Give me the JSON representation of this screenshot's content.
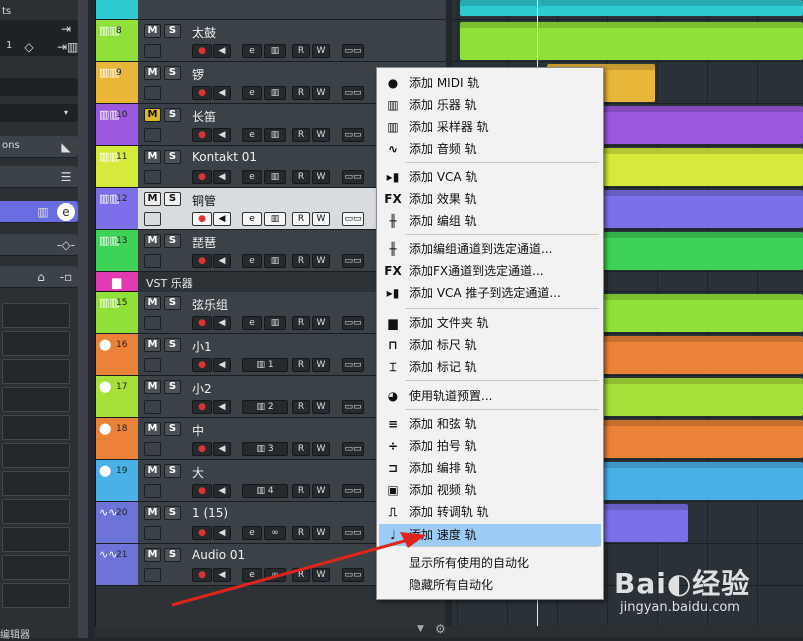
{
  "inspector": {
    "rows": [
      {
        "text": "ts",
        "icon": "",
        "y": 2
      },
      {
        "text": "",
        "icon": "⇥",
        "y": 22
      },
      {
        "text": "1",
        "icon": "◇",
        "y": 40
      }
    ],
    "ons_label": "ons",
    "bottom_label": "编辑器"
  },
  "tracks": [
    {
      "num": "8",
      "name": "太鼓",
      "color": "#8fe13a",
      "type": "instrument"
    },
    {
      "num": "9",
      "name": "锣",
      "color": "#e8b73a",
      "type": "instrument"
    },
    {
      "num": "10",
      "name": "长笛",
      "color": "#9a58e0",
      "type": "instrument",
      "monitor": true
    },
    {
      "num": "11",
      "name": "Kontakt 01",
      "color": "#d6ea3c",
      "type": "instrument"
    },
    {
      "num": "12",
      "name": "铜管",
      "color": "#7b70e8",
      "type": "instrument",
      "selected": true
    },
    {
      "num": "13",
      "name": "琵琶",
      "color": "#3ed256",
      "type": "instrument"
    },
    {
      "num": "15",
      "name": "弦乐组",
      "color": "#8fe13a",
      "type": "instrument"
    },
    {
      "num": "16",
      "name": "小1",
      "color": "#ea8337",
      "type": "midi",
      "channel": "1"
    },
    {
      "num": "17",
      "name": "小2",
      "color": "#a8e03a",
      "type": "midi",
      "channel": "2"
    },
    {
      "num": "18",
      "name": "中",
      "color": "#ea8337",
      "type": "midi",
      "channel": "3"
    },
    {
      "num": "19",
      "name": "大",
      "color": "#4ab1e8",
      "type": "midi",
      "channel": "4"
    },
    {
      "num": "20",
      "name": "1 (15)",
      "color": "#6c74d8",
      "type": "audio"
    },
    {
      "num": "21",
      "name": "Audio 01",
      "color": "#6c74d8",
      "type": "audio"
    }
  ],
  "folder": {
    "name": "VST 乐器"
  },
  "buttons": {
    "mute": "M",
    "solo": "S",
    "read": "R",
    "write": "W",
    "edit": "e"
  },
  "menu": {
    "items": [
      {
        "label": "添加 MIDI 轨",
        "icon": "midi-icon",
        "glyph": "●"
      },
      {
        "label": "添加 乐器 轨",
        "icon": "instrument-icon",
        "glyph": "▥"
      },
      {
        "label": "添加 采样器 轨",
        "icon": "sampler-icon",
        "glyph": "▥"
      },
      {
        "label": "添加 音频 轨",
        "icon": "audio-wave-icon",
        "glyph": "∿"
      },
      {
        "label": "添加 VCA 轨",
        "icon": "vca-icon",
        "glyph": "▸▮"
      },
      {
        "label": "添加 效果 轨",
        "icon": "fx-icon",
        "glyph": "FX"
      },
      {
        "label": "添加 编组 轨",
        "icon": "group-icon",
        "glyph": "╫"
      },
      {
        "label": "添加编组通道到选定通道...",
        "icon": "group-icon",
        "glyph": "╫"
      },
      {
        "label": "添加FX通道到选定通道...",
        "icon": "fx-icon",
        "glyph": "FX"
      },
      {
        "label": "添加 VCA 推子到选定通道...",
        "icon": "vca-icon",
        "glyph": "▸▮"
      },
      {
        "label": "添加 文件夹 轨",
        "icon": "folder-icon",
        "glyph": "▆"
      },
      {
        "label": "添加 标尺 轨",
        "icon": "ruler-icon",
        "glyph": "⊓"
      },
      {
        "label": "添加 标记 轨",
        "icon": "marker-icon",
        "glyph": "⌶"
      },
      {
        "label": "使用轨道预置...",
        "icon": "preset-icon",
        "glyph": "◕"
      },
      {
        "label": "添加 和弦 轨",
        "icon": "chord-icon",
        "glyph": "≡"
      },
      {
        "label": "添加 拍号 轨",
        "icon": "signature-icon",
        "glyph": "÷"
      },
      {
        "label": "添加 编排 轨",
        "icon": "arranger-icon",
        "glyph": "⊐"
      },
      {
        "label": "添加 视频 轨",
        "icon": "video-icon",
        "glyph": "▣"
      },
      {
        "label": "添加 转调轨 轨",
        "icon": "transpose-icon",
        "glyph": "⎍"
      },
      {
        "label": "添加 速度 轨",
        "icon": "tempo-icon",
        "glyph": "♩"
      },
      {
        "label": "显示所有使用的自动化",
        "icon": "",
        "glyph": ""
      },
      {
        "label": "隐藏所有自动化",
        "icon": "",
        "glyph": ""
      }
    ]
  },
  "watermark": {
    "main": "Bai◐经验",
    "url": "jingyan.baidu.com"
  }
}
